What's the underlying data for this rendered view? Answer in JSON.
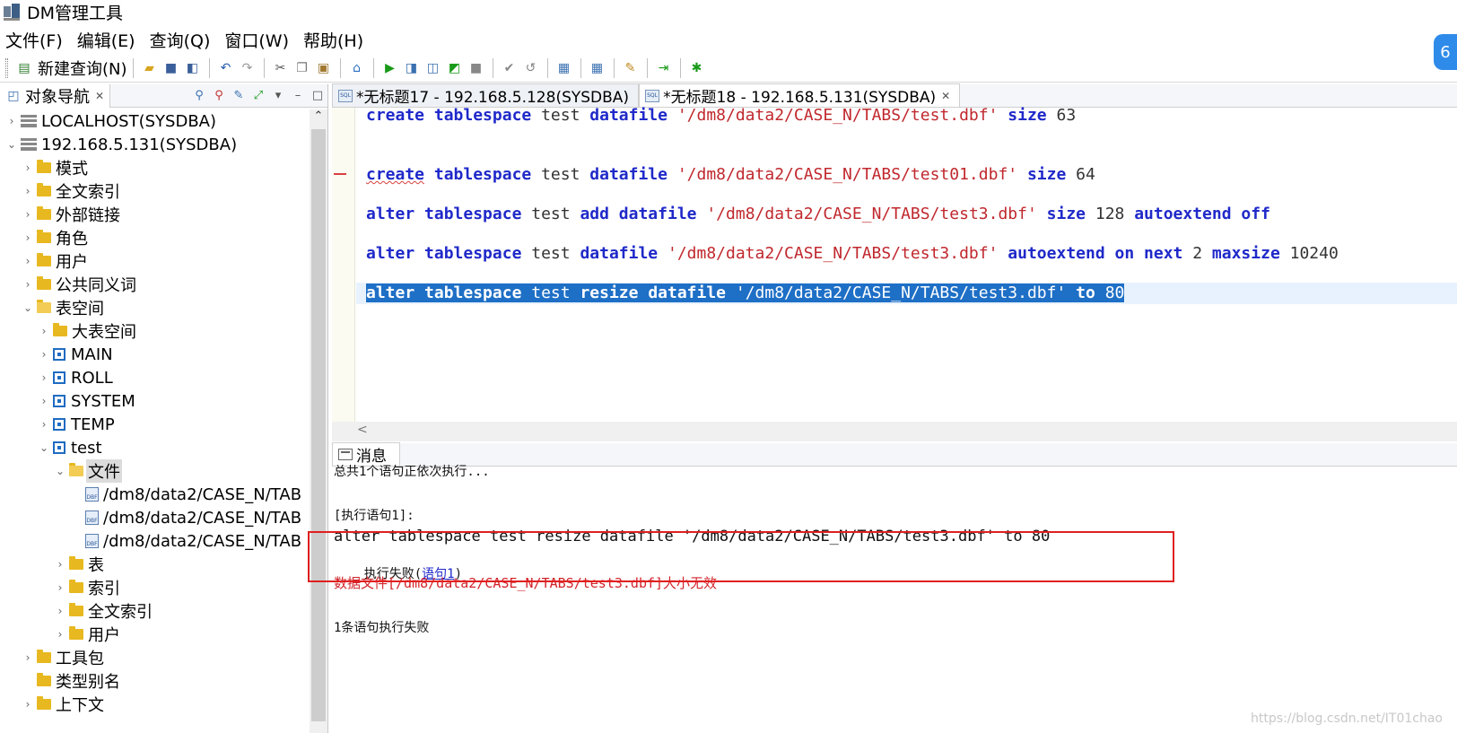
{
  "window": {
    "title": "DM管理工具"
  },
  "menu": [
    "文件(F)",
    "编辑(E)",
    "查询(Q)",
    "窗口(W)",
    "帮助(H)"
  ],
  "toolbar": {
    "new_query_label": "新建查询(N)"
  },
  "navigator": {
    "tab_label": "对象导航",
    "tree": [
      {
        "label": "LOCALHOST(SYSDBA)",
        "icon": "server-icon",
        "depth": 0,
        "arrow": ">"
      },
      {
        "label": "192.168.5.131(SYSDBA)",
        "icon": "server-icon",
        "depth": 0,
        "arrow": "v"
      },
      {
        "label": "模式",
        "icon": "folder-icon",
        "depth": 1,
        "arrow": ">"
      },
      {
        "label": "全文索引",
        "icon": "folder-icon",
        "depth": 1,
        "arrow": ">"
      },
      {
        "label": "外部链接",
        "icon": "folder-icon",
        "depth": 1,
        "arrow": ">"
      },
      {
        "label": "角色",
        "icon": "folder-icon",
        "depth": 1,
        "arrow": ">"
      },
      {
        "label": "用户",
        "icon": "folder-icon",
        "depth": 1,
        "arrow": ">"
      },
      {
        "label": "公共同义词",
        "icon": "folder-icon",
        "depth": 1,
        "arrow": ">"
      },
      {
        "label": "表空间",
        "icon": "folder-open-icon",
        "depth": 1,
        "arrow": "v"
      },
      {
        "label": "大表空间",
        "icon": "folder-icon",
        "depth": 2,
        "arrow": ">"
      },
      {
        "label": "MAIN",
        "icon": "tablespace-icon",
        "depth": 2,
        "arrow": ">"
      },
      {
        "label": "ROLL",
        "icon": "tablespace-icon",
        "depth": 2,
        "arrow": ">"
      },
      {
        "label": "SYSTEM",
        "icon": "tablespace-icon",
        "depth": 2,
        "arrow": ">"
      },
      {
        "label": "TEMP",
        "icon": "tablespace-icon",
        "depth": 2,
        "arrow": ">"
      },
      {
        "label": "test",
        "icon": "tablespace-icon",
        "depth": 2,
        "arrow": "v"
      },
      {
        "label": "文件",
        "icon": "folder-open-icon",
        "depth": 3,
        "arrow": "v",
        "selected": true
      },
      {
        "label": "/dm8/data2/CASE_N/TAB",
        "icon": "dbf-file-icon",
        "depth": 4,
        "arrow": ""
      },
      {
        "label": "/dm8/data2/CASE_N/TAB",
        "icon": "dbf-file-icon",
        "depth": 4,
        "arrow": ""
      },
      {
        "label": "/dm8/data2/CASE_N/TAB",
        "icon": "dbf-file-icon",
        "depth": 4,
        "arrow": ""
      },
      {
        "label": "表",
        "icon": "folder-icon",
        "depth": 3,
        "arrow": ">"
      },
      {
        "label": "索引",
        "icon": "folder-icon",
        "depth": 3,
        "arrow": ">"
      },
      {
        "label": "全文索引",
        "icon": "folder-icon",
        "depth": 3,
        "arrow": ">"
      },
      {
        "label": "用户",
        "icon": "folder-icon",
        "depth": 3,
        "arrow": ">"
      },
      {
        "label": "工具包",
        "icon": "folder-icon",
        "depth": 1,
        "arrow": ">"
      },
      {
        "label": "类型别名",
        "icon": "folder-icon",
        "depth": 1,
        "arrow": ""
      },
      {
        "label": "上下文",
        "icon": "folder-icon",
        "depth": 1,
        "arrow": ">"
      }
    ]
  },
  "editor_tabs": [
    {
      "label": "*无标题17 - 192.168.5.128(SYSDBA)",
      "active": false
    },
    {
      "label": "*无标题18 - 192.168.5.131(SYSDBA)",
      "active": true
    }
  ],
  "editor": {
    "lines": [
      [
        [
          "kw",
          "create"
        ],
        [
          "ident",
          " "
        ],
        [
          "kw",
          "tablespace"
        ],
        [
          "ident",
          " test "
        ],
        [
          "kw",
          "datafile"
        ],
        [
          "ident",
          " "
        ],
        [
          "str",
          "'/dm8/data2/CASE_N/TABS/test.dbf'"
        ],
        [
          "ident",
          " "
        ],
        [
          "kw",
          "size"
        ],
        [
          "num",
          " 63"
        ]
      ],
      [
        [
          "kw",
          "create"
        ],
        [
          "ident",
          " "
        ],
        [
          "kw",
          "tablespace"
        ],
        [
          "ident",
          " test "
        ],
        [
          "kw",
          "datafile"
        ],
        [
          "ident",
          " "
        ],
        [
          "str",
          "'/dm8/data2/CASE_N/TABS/test01.dbf'"
        ],
        [
          "ident",
          " "
        ],
        [
          "kw",
          "size"
        ],
        [
          "num",
          " 64"
        ]
      ],
      [
        [
          "kw",
          "alter"
        ],
        [
          "ident",
          " "
        ],
        [
          "kw",
          "tablespace"
        ],
        [
          "ident",
          " test "
        ],
        [
          "kw",
          "add"
        ],
        [
          "ident",
          " "
        ],
        [
          "kw",
          "datafile"
        ],
        [
          "ident",
          " "
        ],
        [
          "str",
          "'/dm8/data2/CASE_N/TABS/test3.dbf'"
        ],
        [
          "ident",
          " "
        ],
        [
          "kw",
          "size"
        ],
        [
          "num",
          " 128 "
        ],
        [
          "kw",
          "autoextend"
        ],
        [
          "ident",
          " "
        ],
        [
          "kw",
          "off"
        ]
      ],
      [
        [
          "kw",
          "alter"
        ],
        [
          "ident",
          " "
        ],
        [
          "kw",
          "tablespace"
        ],
        [
          "ident",
          " test "
        ],
        [
          "kw",
          "datafile"
        ],
        [
          "ident",
          " "
        ],
        [
          "str",
          "'/dm8/data2/CASE_N/TABS/test3.dbf'"
        ],
        [
          "ident",
          " "
        ],
        [
          "kw",
          "autoextend"
        ],
        [
          "ident",
          " "
        ],
        [
          "kw",
          "on"
        ],
        [
          "ident",
          " "
        ],
        [
          "kw",
          "next"
        ],
        [
          "num",
          " 2 "
        ],
        [
          "kw",
          "maxsize"
        ],
        [
          "num",
          " 10240"
        ]
      ],
      [
        [
          "kw",
          "alter"
        ],
        [
          "ident",
          " "
        ],
        [
          "kw",
          "tablespace"
        ],
        [
          "ident",
          " test "
        ],
        [
          "kw",
          "resize"
        ],
        [
          "ident",
          " "
        ],
        [
          "kw",
          "datafile"
        ],
        [
          "ident",
          " "
        ],
        [
          "str",
          "'/dm8/data2/CASE_N/TABS/test3.dbf'"
        ],
        [
          "ident",
          " "
        ],
        [
          "kw",
          "to"
        ],
        [
          "num",
          " 80"
        ]
      ]
    ]
  },
  "messages": {
    "tab_label": "消息",
    "summary": "总共1个语句正依次执行...",
    "exec_header": "[执行语句1]:",
    "statement": "alter tablespace test resize datafile '/dm8/data2/CASE_N/TABS/test3.dbf' to 80",
    "fail_prefix": "执行失败(",
    "fail_link": "语句1",
    "fail_suffix": ")",
    "error": "数据文件[/dm8/data2/CASE_N/TABS/test3.dbf]大小无效",
    "footer": "1条语句执行失败"
  },
  "watermark": "https://blog.csdn.net/IT01chao"
}
